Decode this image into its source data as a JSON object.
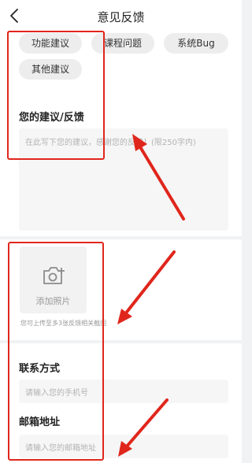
{
  "header": {
    "title": "意见反馈",
    "back_icon": "chevron-left-icon"
  },
  "categories": [
    "功能建议",
    "课程问题",
    "系统Bug",
    "其他建议"
  ],
  "feedback": {
    "label": "您的建议/反馈",
    "placeholder": "在此写下您的建议，感谢您的反馈！(限250字内)"
  },
  "photo": {
    "label": "添加照片",
    "icon": "camera-plus-icon",
    "hint": "您可上传至多3张反馈相关截图"
  },
  "contact": {
    "label": "联系方式",
    "placeholder": "请输入您的手机号"
  },
  "email": {
    "label": "邮箱地址",
    "placeholder": "请输入您的邮箱地址"
  },
  "annotation_color": "#e0261c"
}
